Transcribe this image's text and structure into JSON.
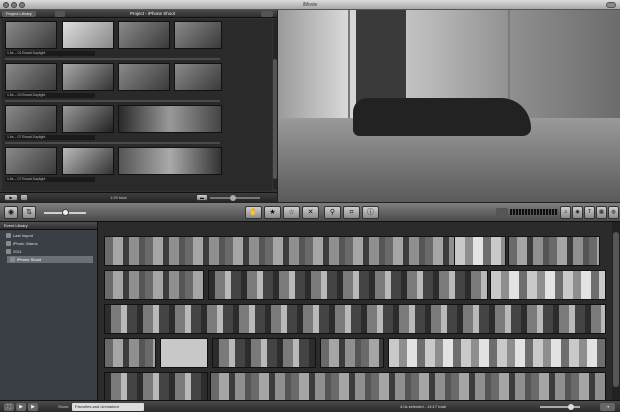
{
  "window": {
    "title": "iMovie"
  },
  "project_pane": {
    "tab_label": "Project Library",
    "title": "Project - iPhone Shoot",
    "clips": [
      {
        "label": "1.6s – 01 Broad Daylight"
      },
      {
        "label": "1.6s – 03 Broad Daylight"
      },
      {
        "label": "1.6s – 07 Broad Daylight"
      },
      {
        "label": "1.6s – 07 Broad Daylight"
      }
    ],
    "footer": {
      "total": "1:29 total"
    }
  },
  "toolbar": {
    "camera_icon": "camera-icon",
    "swap_icon": "swap-icon",
    "tools": [
      {
        "name": "hand-icon",
        "glyph": "✋"
      },
      {
        "name": "star-icon",
        "glyph": "★"
      },
      {
        "name": "star-outline-icon",
        "glyph": "☆"
      },
      {
        "name": "reject-icon",
        "glyph": "✕"
      },
      {
        "name": "keyword-icon",
        "glyph": "⚲"
      },
      {
        "name": "crop-icon",
        "glyph": "⌗"
      },
      {
        "name": "info-icon",
        "glyph": "ⓘ"
      }
    ],
    "browser_buttons": [
      {
        "name": "music-icon",
        "glyph": "♫"
      },
      {
        "name": "photo-icon",
        "glyph": "◉"
      },
      {
        "name": "title-icon",
        "glyph": "T"
      },
      {
        "name": "transition-icon",
        "glyph": "▦"
      },
      {
        "name": "map-icon",
        "glyph": "◍"
      }
    ]
  },
  "event_library": {
    "header": "Event Library",
    "items": [
      {
        "label": "Last Import"
      },
      {
        "label": "iPhoto Videos"
      },
      {
        "label": "2011"
      },
      {
        "label": "iPhone Shoot"
      }
    ]
  },
  "status_bar": {
    "show_label": "Show:",
    "show_value": "Favorites and Unmarked",
    "selection": "4.0s selected - 14:17 total",
    "fx_label": "⇥"
  },
  "colors": {
    "accent": "#6b6f78",
    "background": "#1e1e1e"
  }
}
